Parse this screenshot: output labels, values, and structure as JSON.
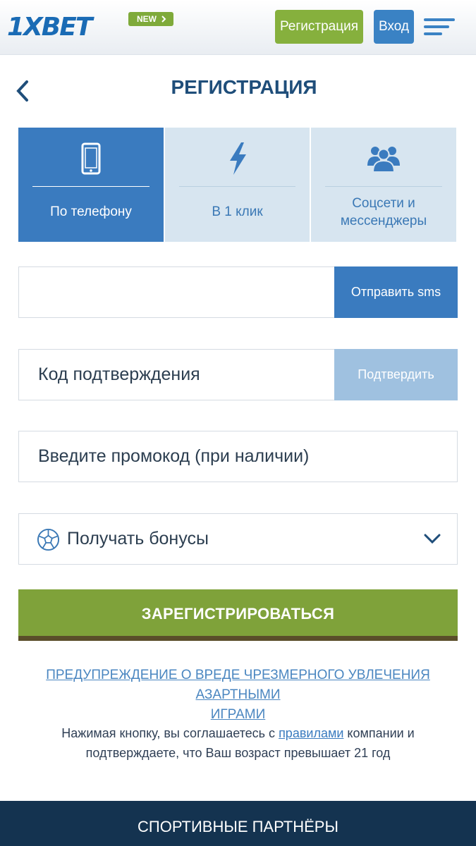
{
  "header": {
    "logo": "1XBET",
    "new_badge": "NEW",
    "register_button": "Регистрация",
    "login_button": "Вход"
  },
  "page": {
    "title": "РЕГИСТРАЦИЯ"
  },
  "tabs": [
    {
      "label": "По телефону",
      "icon": "phone-icon",
      "active": true
    },
    {
      "label": "В 1 клик",
      "icon": "lightning-icon",
      "active": false
    },
    {
      "label_line1": "Соцсети и",
      "label_line2": "мессенджеры",
      "icon": "users-icon",
      "active": false
    }
  ],
  "form": {
    "phone_value": "",
    "send_sms_button": "Отправить sms",
    "code_placeholder": "Код подтверждения",
    "confirm_button": "Подтвердить",
    "promo_placeholder": "Введите промокод (при наличии)",
    "bonus_select_value": "Получать бонусы",
    "register_button": "ЗАРЕГИСТРИРОВАТЬСЯ"
  },
  "warning": {
    "line1": "ПРЕДУПРЕЖДЕНИЕ О ВРЕДЕ ЧРЕЗМЕРНОГО УВЛЕЧЕНИЯ АЗАРТНЫМИ",
    "line2": "ИГРАМИ"
  },
  "terms": {
    "prefix": "Нажимая кнопку, вы соглашаетесь с ",
    "link": "правилами",
    "suffix_line1": " компании и",
    "line2": "подтверждаете, что Ваш возраст превышает 21 год"
  },
  "footer": {
    "title": "СПОРТИВНЫЕ ПАРТНЁРЫ"
  },
  "colors": {
    "brand_blue": "#3a7bbf",
    "accent_green": "#7fa23a",
    "footer_navy": "#143350"
  }
}
